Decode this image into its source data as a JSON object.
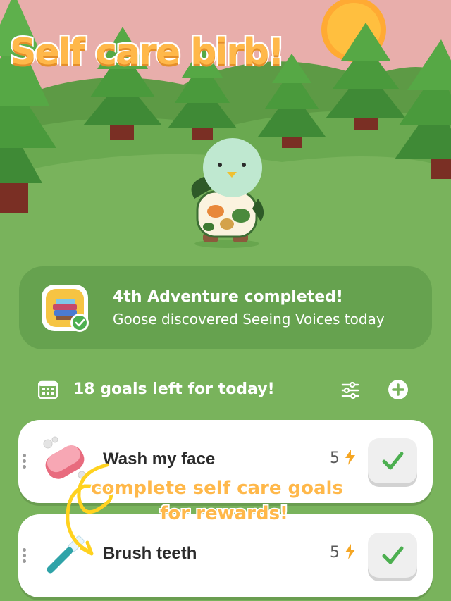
{
  "header": {
    "title": "Self care birb!"
  },
  "adventure": {
    "title": "4th Adventure completed!",
    "subtitle": "Goose discovered Seeing Voices today"
  },
  "goals": {
    "summary": "18 goals left for today!",
    "items": [
      {
        "label": "Wash my face",
        "reward": "5",
        "icon": "soap-icon"
      },
      {
        "label": "Brush teeth",
        "reward": "5",
        "icon": "toothbrush-icon"
      }
    ]
  },
  "annotation": {
    "line1": "complete self care goals",
    "line2": "for rewards!"
  },
  "colors": {
    "sky": "#e8aeab",
    "grass": "#79b35c",
    "card_green": "#66a24f",
    "accent_orange": "#ffb84a",
    "check_green": "#4caf50",
    "bolt": "#f5a623"
  }
}
